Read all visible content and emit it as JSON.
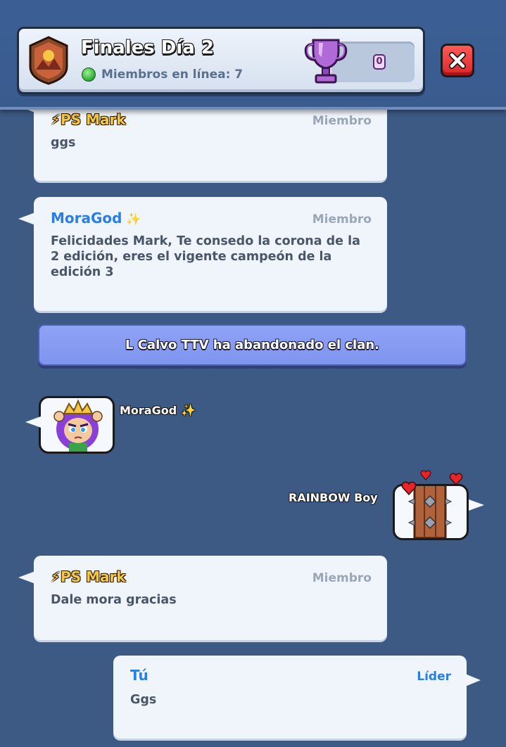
{
  "header": {
    "clan_name": "Finales Día 2",
    "online_label": "Miembros en línea: 7",
    "trophy_count": "0"
  },
  "messages": [
    {
      "sender": "PS Mark",
      "role": "Miembro",
      "text": "ggs"
    },
    {
      "sender": "MoraGod",
      "role": "Miembro",
      "text": "Felicidades Mark, Te consedo la corona de la 2 edición, eres el vigente campeón de la edición 3"
    },
    {
      "sender": "PS Mark",
      "role": "Miembro",
      "text": "Dale mora gracias"
    },
    {
      "sender": "Tú",
      "role": "Líder",
      "text": "Ggs"
    }
  ],
  "system_notice": "L Calvo TTV ha abandonado el clan.",
  "emotes": [
    {
      "sender": "MoraGod",
      "emote": "archer-queen-emote"
    },
    {
      "sender": "RAINBOW Boy",
      "emote": "wall-hearts-emote"
    }
  ],
  "colors": {
    "background": "#3d5a85",
    "bubble": "#f0f5fc",
    "sender_blue": "#2a7ee6",
    "sender_gold": "#f6c744",
    "notice": "#8ea2f5",
    "close_red": "#d8262a"
  }
}
